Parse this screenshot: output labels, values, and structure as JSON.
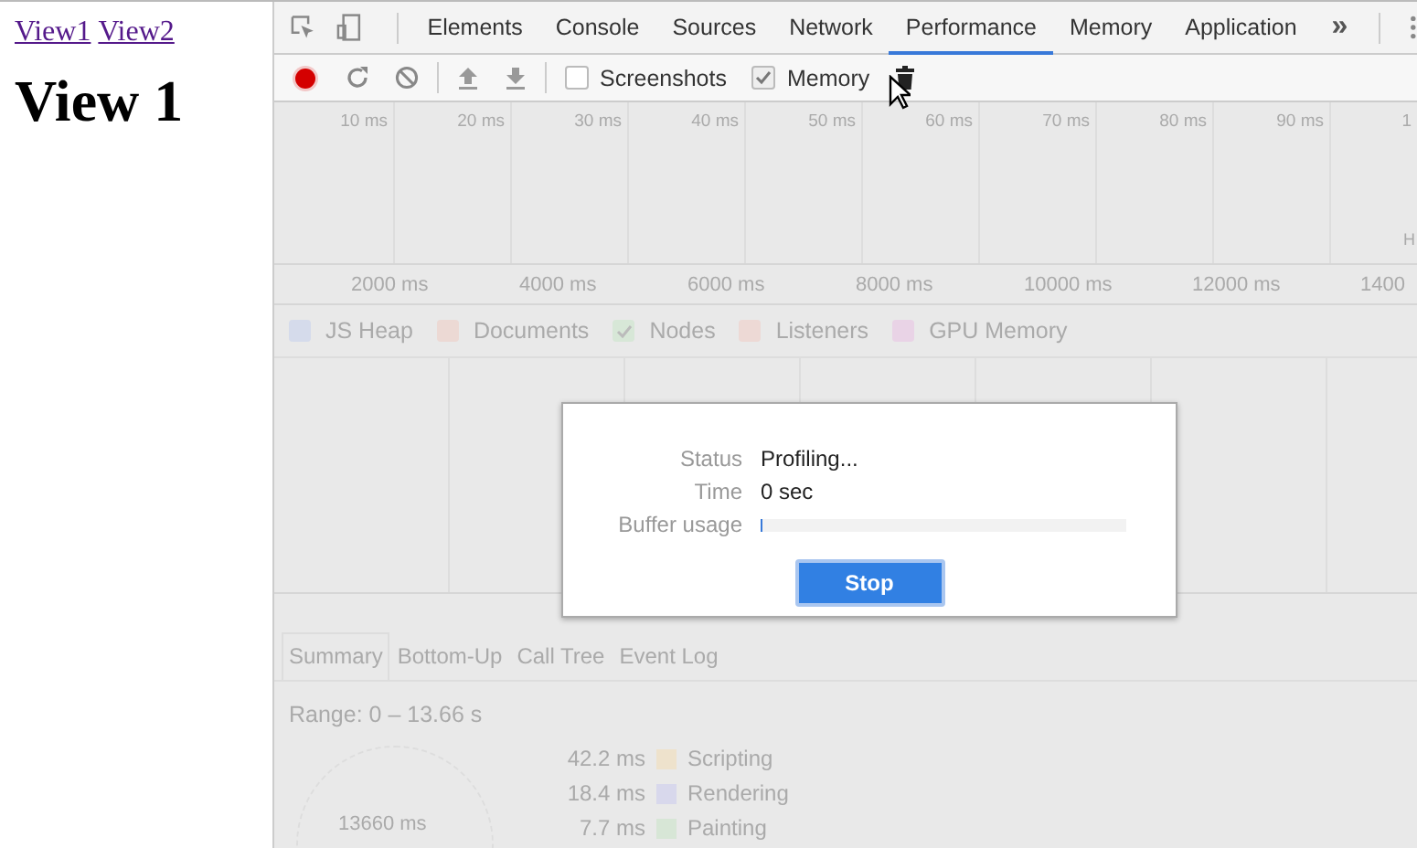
{
  "page": {
    "links": [
      "View1",
      "View2"
    ],
    "heading": "View 1"
  },
  "devtools": {
    "tabs": [
      {
        "label": "Elements",
        "selected": false
      },
      {
        "label": "Console",
        "selected": false
      },
      {
        "label": "Sources",
        "selected": false
      },
      {
        "label": "Network",
        "selected": false
      },
      {
        "label": "Performance",
        "selected": true
      },
      {
        "label": "Memory",
        "selected": false
      },
      {
        "label": "Application",
        "selected": false
      }
    ],
    "more_tabs": "»",
    "toolbar": {
      "options": [
        {
          "label": "Screenshots",
          "checked": false
        },
        {
          "label": "Memory",
          "checked": true
        }
      ]
    },
    "overview": {
      "ticks": [
        "10 ms",
        "20 ms",
        "30 ms",
        "40 ms",
        "50 ms",
        "60 ms",
        "70 ms",
        "80 ms",
        "90 ms",
        "1"
      ],
      "corner_label": "H"
    },
    "ruler": [
      "2000 ms",
      "4000 ms",
      "6000 ms",
      "8000 ms",
      "10000 ms",
      "12000 ms",
      "1400"
    ],
    "counters": [
      {
        "label": "JS Heap",
        "color": "#d5dbeb",
        "checked": false
      },
      {
        "label": "Documents",
        "color": "#ecd9d4",
        "checked": false
      },
      {
        "label": "Nodes",
        "color": "#d7e7d7",
        "checked": true
      },
      {
        "label": "Listeners",
        "color": "#edd9d5",
        "checked": false
      },
      {
        "label": "GPU Memory",
        "color": "#e9d3e6",
        "checked": false
      }
    ],
    "details_tabs": [
      {
        "label": "Summary",
        "selected": true
      },
      {
        "label": "Bottom-Up",
        "selected": false
      },
      {
        "label": "Call Tree",
        "selected": false
      },
      {
        "label": "Event Log",
        "selected": false
      }
    ],
    "range": "Range: 0 – 13.66 s",
    "summary": {
      "total": "13660 ms",
      "rows": [
        {
          "time": "42.2 ms",
          "label": "Scripting",
          "color": "#eee2cc"
        },
        {
          "time": "18.4 ms",
          "label": "Rendering",
          "color": "#d8d8ec"
        },
        {
          "time": "7.7 ms",
          "label": "Painting",
          "color": "#d7e6d6"
        }
      ]
    }
  },
  "dialog": {
    "fields": [
      {
        "label": "Status",
        "value": "Profiling..."
      },
      {
        "label": "Time",
        "value": "0 sec"
      }
    ],
    "buffer": {
      "label": "Buffer usage",
      "level": 0.005
    },
    "button": "Stop"
  }
}
